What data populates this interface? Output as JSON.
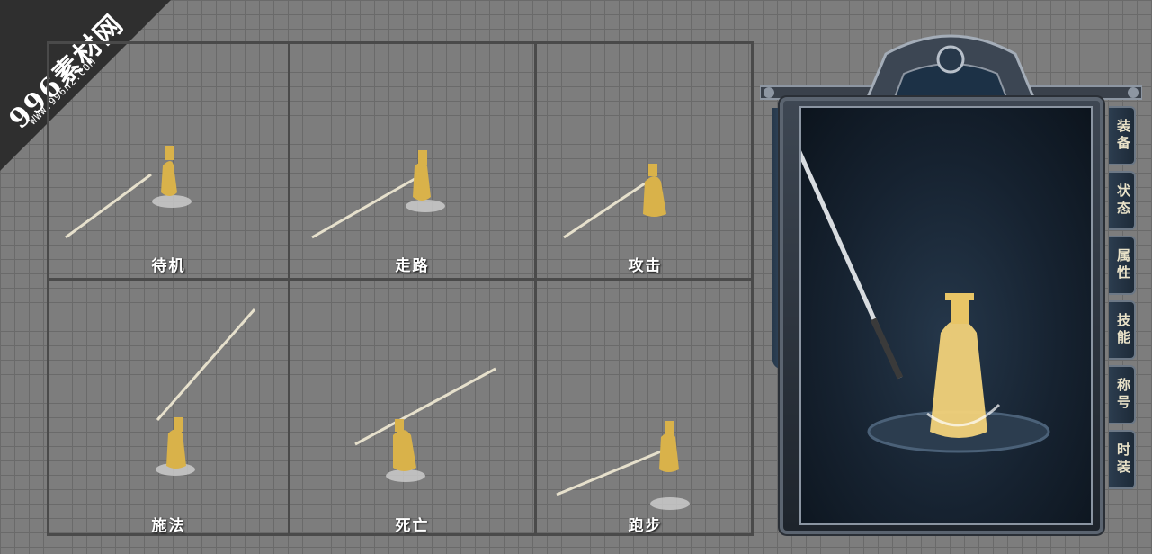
{
  "watermark": {
    "big": "996素材网",
    "small": "WWW.996n2.COM"
  },
  "actions": [
    {
      "label": "待机"
    },
    {
      "label": "走路"
    },
    {
      "label": "攻击"
    },
    {
      "label": "施法"
    },
    {
      "label": "死亡"
    },
    {
      "label": "跑步"
    }
  ],
  "panel": {
    "tabs": [
      {
        "label": "装备"
      },
      {
        "label": "状态"
      },
      {
        "label": "属性"
      },
      {
        "label": "技能"
      },
      {
        "label": "称号"
      },
      {
        "label": "时装"
      }
    ]
  },
  "colors": {
    "gold": "#d9b24a",
    "panel_dark": "#1e242c",
    "grid_line": "#4a4a4a"
  }
}
